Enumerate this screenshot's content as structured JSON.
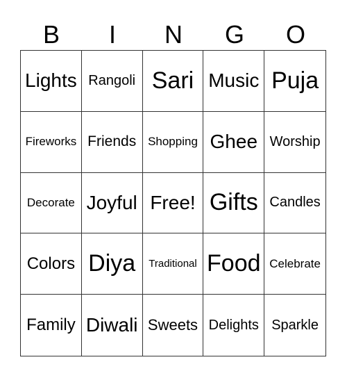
{
  "header": [
    "B",
    "I",
    "N",
    "G",
    "O"
  ],
  "cells": [
    "Lights",
    "Rangoli",
    "Sari",
    "Music",
    "Puja",
    "Fireworks",
    "Friends",
    "Shopping",
    "Ghee",
    "Worship",
    "Decorate",
    "Joyful",
    "Free!",
    "Gifts",
    "Candles",
    "Colors",
    "Diya",
    "Traditional",
    "Food",
    "Celebrate",
    "Family",
    "Diwali",
    "Sweets",
    "Delights",
    "Sparkle"
  ]
}
